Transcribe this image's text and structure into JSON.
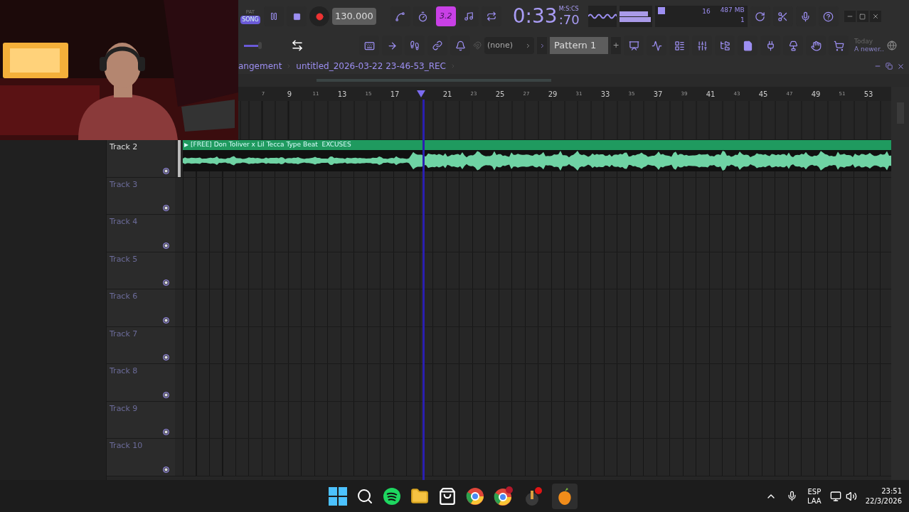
{
  "transport": {
    "mode_small": "PAT",
    "mode": "SONG",
    "song_mode": true,
    "tempo": "130.000",
    "time": "0:33",
    "time_cs": ":70",
    "time_unit": "M:S:CS"
  },
  "snap_button": {
    "label": "3.2",
    "on": true
  },
  "cpu": {
    "polyphony": "16",
    "memory": "487 MB",
    "voices": "1"
  },
  "master_volume": {
    "level": 0.4
  },
  "pattern": {
    "snap": "(none)",
    "name": "Pattern 1",
    "add": "+"
  },
  "hint": {
    "title": "Today",
    "text": "A newer.."
  },
  "breadcrumb": [
    "angement",
    "untitled_2026-03-22 23-46-53_REC"
  ],
  "ruler": [
    {
      "kind": "number",
      "label": "7",
      "major": false
    },
    {
      "kind": "number",
      "label": "9",
      "major": true
    },
    {
      "kind": "number",
      "label": "11",
      "major": false
    },
    {
      "kind": "number",
      "label": "13",
      "major": true
    },
    {
      "kind": "number",
      "label": "15",
      "major": false
    },
    {
      "kind": "number",
      "label": "17",
      "major": true
    },
    {
      "kind": "playhead"
    },
    {
      "kind": "number",
      "label": "21",
      "major": true
    },
    {
      "kind": "number",
      "label": "23",
      "major": false
    },
    {
      "kind": "number",
      "label": "25",
      "major": true
    },
    {
      "kind": "number",
      "label": "27",
      "major": false
    },
    {
      "kind": "number",
      "label": "29",
      "major": true
    },
    {
      "kind": "number",
      "label": "31",
      "major": false
    },
    {
      "kind": "number",
      "label": "33",
      "major": true
    },
    {
      "kind": "number",
      "label": "35",
      "major": false
    },
    {
      "kind": "number",
      "label": "37",
      "major": true
    },
    {
      "kind": "number",
      "label": "39",
      "major": false
    },
    {
      "kind": "number",
      "label": "41",
      "major": true
    },
    {
      "kind": "number",
      "label": "43",
      "major": false
    },
    {
      "kind": "number",
      "label": "45",
      "major": true
    },
    {
      "kind": "number",
      "label": "47",
      "major": false
    },
    {
      "kind": "number",
      "label": "49",
      "major": true
    },
    {
      "kind": "number",
      "label": "51",
      "major": false
    },
    {
      "kind": "number",
      "label": "53",
      "major": true
    }
  ],
  "tracks": [
    {
      "name": "Track 2",
      "selected": true,
      "clip": "[FREE] Don Toliver x Lil Tecca Type Beat  EXCUSES"
    },
    {
      "name": "Track 3",
      "selected": false
    },
    {
      "name": "Track 4",
      "selected": false
    },
    {
      "name": "Track 5",
      "selected": false
    },
    {
      "name": "Track 6",
      "selected": false
    },
    {
      "name": "Track 7",
      "selected": false
    },
    {
      "name": "Track 8",
      "selected": false
    },
    {
      "name": "Track 9",
      "selected": false
    },
    {
      "name": "Track 10",
      "selected": false
    }
  ],
  "taskbar": {
    "language": "ESP",
    "layout": "LAA",
    "time": "23:51",
    "date": "22/3/2026"
  }
}
